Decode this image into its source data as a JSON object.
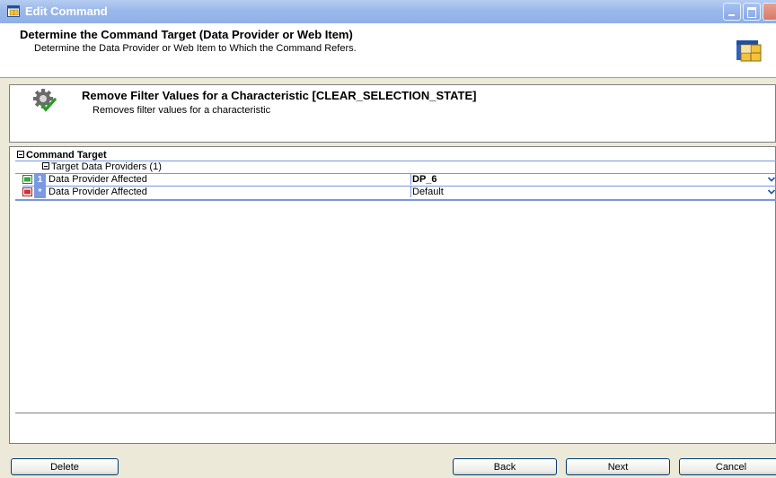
{
  "window": {
    "title": "Edit Command"
  },
  "header": {
    "title": "Determine the Command Target (Data Provider or Web Item)",
    "subtitle": "Determine the Data Provider or Web Item to Which the Command Refers."
  },
  "command": {
    "title": "Remove Filter Values for a Characteristic [CLEAR_SELECTION_STATE]",
    "description": "Removes filter values for a characteristic"
  },
  "grid": {
    "section_label": "Command Target",
    "group_label": "Target Data Providers (1)",
    "rows": [
      {
        "index": "1",
        "label": "Data Provider Affected",
        "value": "DP_6"
      },
      {
        "index": "*",
        "label": "Data Provider Affected",
        "value": "Default"
      }
    ]
  },
  "buttons": {
    "delete": "Delete",
    "back": "Back",
    "next": "Next",
    "cancel": "Cancel"
  },
  "colors": {
    "titlebar": "#9bb8ea",
    "row_index": "#7b9ae0",
    "grid_line": "#7a96df"
  }
}
